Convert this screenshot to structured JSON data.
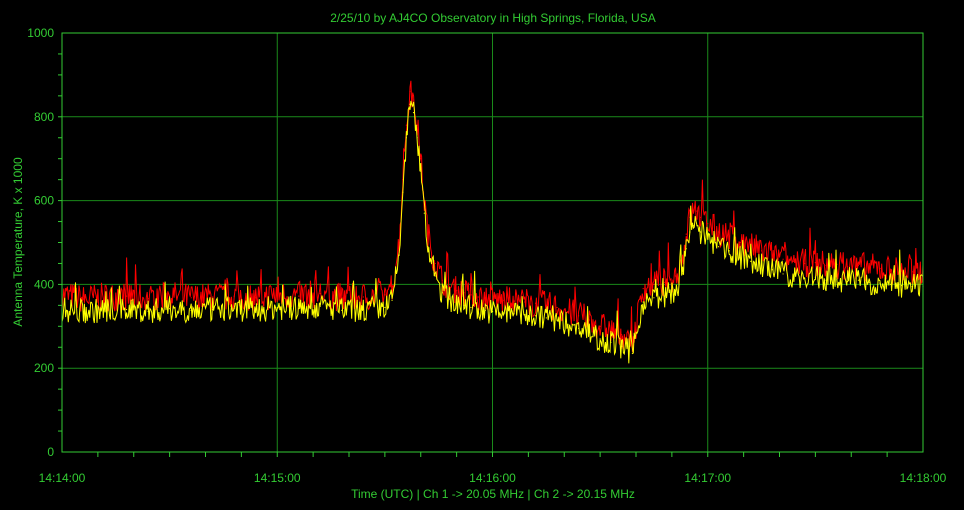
{
  "chart_data": {
    "type": "line",
    "title": "2/25/10  by  AJ4CO Observatory  in  High Springs, Florida, USA",
    "xlabel": "Time (UTC)  |  Ch 1 -> 20.05 MHz  |  Ch 2 -> 20.15 MHz",
    "ylabel": "Antenna Temperature, K x 1000",
    "ylim": [
      0,
      1000
    ],
    "yticks": [
      "0",
      "200",
      "400",
      "600",
      "800",
      "1000"
    ],
    "xlim_seconds": [
      0,
      240
    ],
    "xticks": [
      "14:14:00",
      "14:15:00",
      "14:16:00",
      "14:17:00",
      "14:18:00"
    ],
    "grid": true,
    "colors": {
      "background": "#000000",
      "axis_text": "#33cc33",
      "grid": "#1a8a1a",
      "ch1": "#ff0000",
      "ch2": "#ffff00"
    },
    "series": [
      {
        "color": "#ff0000",
        "x_seconds": [
          0,
          6,
          12,
          18,
          24,
          30,
          36,
          42,
          48,
          54,
          60,
          66,
          72,
          78,
          84,
          90,
          92,
          94,
          95,
          96,
          97,
          98,
          99,
          100,
          101,
          102,
          104,
          106,
          108,
          110,
          112,
          114,
          116,
          118,
          120,
          123,
          126,
          129,
          132,
          135,
          138,
          141,
          144,
          147,
          150,
          153,
          156,
          159,
          162,
          165,
          168,
          171,
          173,
          174,
          175,
          176,
          177,
          178,
          180,
          183,
          186,
          189,
          192,
          195,
          198,
          201,
          204,
          207,
          210,
          213,
          216,
          219,
          222,
          225,
          228,
          231,
          234,
          237,
          240
        ],
        "values": [
          375,
          365,
          370,
          372,
          366,
          374,
          368,
          370,
          372,
          368,
          375,
          372,
          378,
          368,
          370,
          375,
          395,
          500,
          650,
          780,
          860,
          840,
          780,
          700,
          600,
          520,
          450,
          410,
          395,
          385,
          380,
          375,
          370,
          368,
          365,
          362,
          360,
          358,
          355,
          350,
          345,
          335,
          325,
          315,
          300,
          290,
          280,
          260,
          390,
          400,
          405,
          420,
          460,
          520,
          560,
          575,
          575,
          560,
          545,
          525,
          515,
          500,
          490,
          480,
          470,
          460,
          455,
          450,
          452,
          445,
          448,
          442,
          445,
          440,
          438,
          435,
          432,
          430,
          430
        ]
      },
      {
        "color": "#ffff00",
        "x_seconds": [
          0,
          6,
          12,
          18,
          24,
          30,
          36,
          42,
          48,
          54,
          60,
          66,
          72,
          78,
          84,
          90,
          92,
          94,
          95,
          96,
          97,
          98,
          99,
          100,
          101,
          102,
          104,
          106,
          108,
          110,
          112,
          114,
          116,
          118,
          120,
          123,
          126,
          129,
          132,
          135,
          138,
          141,
          144,
          147,
          150,
          153,
          156,
          159,
          162,
          165,
          168,
          171,
          173,
          174,
          175,
          176,
          177,
          178,
          180,
          183,
          186,
          189,
          192,
          195,
          198,
          201,
          204,
          207,
          210,
          213,
          216,
          219,
          222,
          225,
          228,
          231,
          234,
          237,
          240
        ],
        "values": [
          340,
          335,
          338,
          340,
          336,
          342,
          338,
          340,
          342,
          338,
          345,
          342,
          348,
          338,
          340,
          345,
          362,
          470,
          620,
          750,
          830,
          810,
          750,
          670,
          570,
          490,
          420,
          380,
          365,
          355,
          350,
          345,
          340,
          338,
          335,
          332,
          330,
          328,
          325,
          320,
          315,
          305,
          295,
          285,
          270,
          262,
          252,
          235,
          358,
          368,
          372,
          385,
          425,
          485,
          525,
          540,
          540,
          525,
          510,
          490,
          480,
          465,
          455,
          445,
          435,
          425,
          420,
          415,
          417,
          410,
          412,
          407,
          410,
          405,
          403,
          400,
          397,
          395,
          395
        ]
      }
    ]
  }
}
